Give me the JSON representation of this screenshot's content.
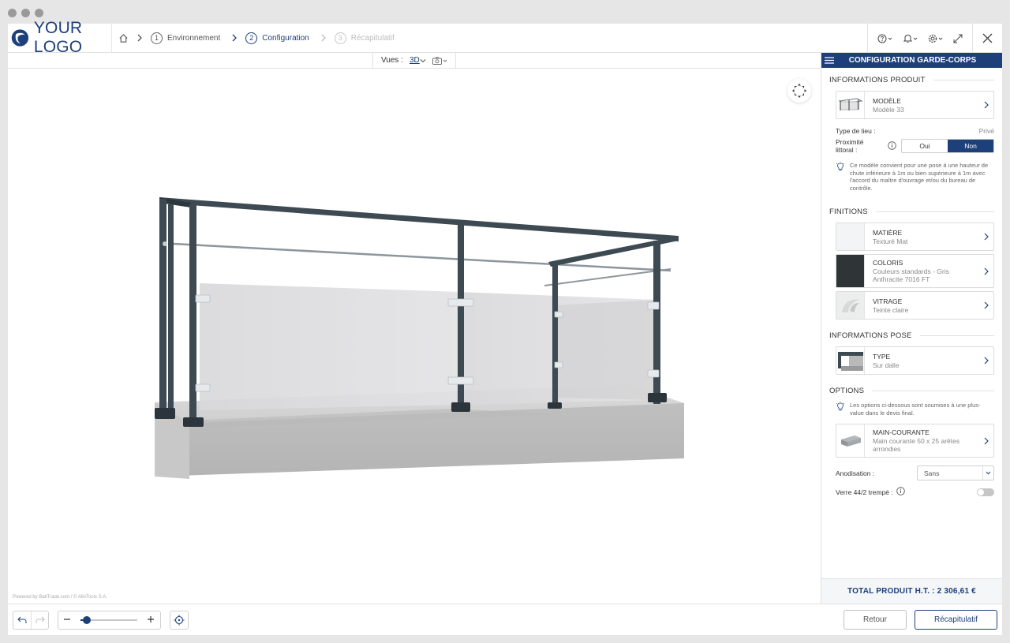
{
  "header": {
    "logo_text": "YOUR LOGO",
    "steps": [
      {
        "num": "1",
        "label": "Environnement"
      },
      {
        "num": "2",
        "label": "Configuration"
      },
      {
        "num": "3",
        "label": "Récapitulatif"
      }
    ]
  },
  "viewbar": {
    "label": "Vues :",
    "view_3d": "3D"
  },
  "canvas": {
    "powered_by": "Powered by BatiTrade.com / © AlloTools S.A."
  },
  "panel": {
    "title": "CONFIGURATION GARDE-CORPS",
    "sections": {
      "product_info": "INFORMATIONS PRODUIT",
      "finishes": "FINITIONS",
      "installation_info": "INFORMATIONS POSE",
      "options": "OPTIONS"
    },
    "model": {
      "label": "MODÈLE",
      "value": "Modèle 33"
    },
    "place_type": {
      "label": "Type de lieu :",
      "value": "Privé"
    },
    "coastal": {
      "label_line1": "Proximité",
      "label_line2": "littoral :",
      "opt_yes": "Oui",
      "opt_no": "Non",
      "selected": "Non"
    },
    "model_tip": "Ce modèle convient pour une pose à une hauteur de chute inférieure à 1m ou bien supérieure à 1m avec l'accord du maître d'ouvrage et/ou du bureau de contrôle.",
    "material": {
      "label": "MATIÈRE",
      "value": "Texturé Mat"
    },
    "color": {
      "label": "COLORIS",
      "value": "Couleurs standards - Gris Anthracite 7016 FT",
      "swatch": "#2f3437"
    },
    "glazing": {
      "label": "VITRAGE",
      "value": "Teinte claire"
    },
    "install_type": {
      "label": "TYPE",
      "value": "Sur dalle"
    },
    "options_tip": "Les options ci-dessous sont soumises à une plus-value dans le devis final.",
    "handrail": {
      "label": "MAIN-COURANTE",
      "value": "Main courante 50 x 25 arêtes arrondies"
    },
    "anodisation": {
      "label": "Anodisation :",
      "value": "Sans"
    },
    "glass_option": {
      "label": "Verre 44/2 trempé :"
    },
    "total": "TOTAL PRODUIT H.T. : 2 306,61 €"
  },
  "footer": {
    "back_label": "Retour",
    "summary_label": "Récapitulatif"
  },
  "colors": {
    "brand": "#1d3f7a",
    "post": "#3d4a52"
  }
}
